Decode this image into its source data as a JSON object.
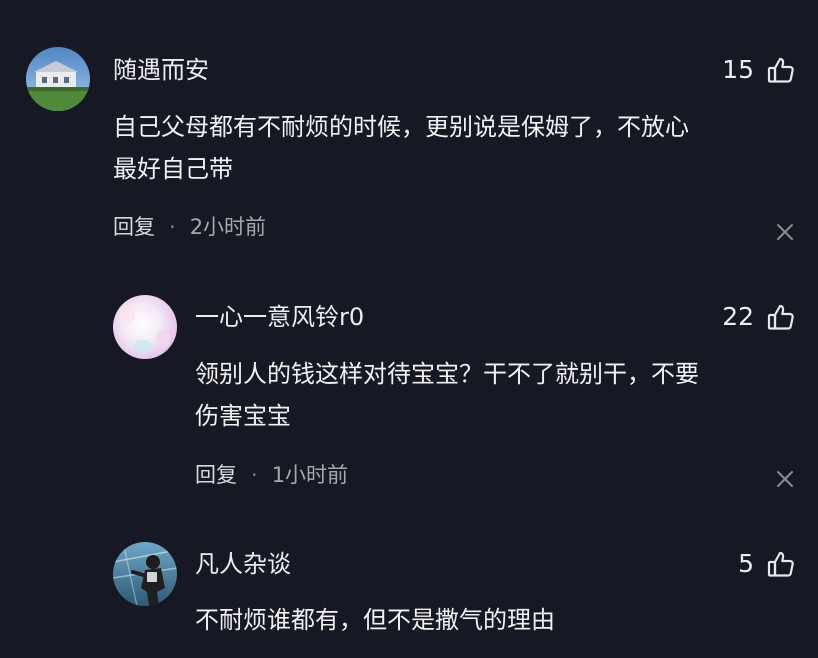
{
  "comments": [
    {
      "username": "随遇而安",
      "text": "自己父母都有不耐烦的时候，更别说是保姆了，不放心\n最好自己带",
      "likes": "15",
      "reply_label": "回复",
      "time": "2小时前",
      "avatar_icon": "avatar-house-photo"
    },
    {
      "username": "一心一意风铃r0",
      "text": "领别人的钱这样对待宝宝？干不了就别干，不要\n伤害宝宝",
      "likes": "22",
      "reply_label": "回复",
      "time": "1小时前",
      "avatar_icon": "avatar-pastel-gradient"
    },
    {
      "username": "凡人杂谈",
      "text": "不耐烦谁都有，但不是撒气的理由",
      "likes": "5",
      "avatar_icon": "avatar-person-photo"
    }
  ],
  "colors": {
    "background": "#161823",
    "text": "#f2f2f3",
    "meta": "#a7a8ad"
  }
}
